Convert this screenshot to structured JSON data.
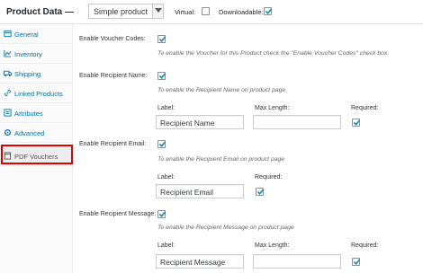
{
  "header": {
    "title": "Product Data —",
    "product_type": "Simple product",
    "virtual_label": "Virtual:",
    "downloadable_label": "Downloadable:"
  },
  "sidebar": {
    "items": [
      {
        "label": "General",
        "icon": "wrench-icon"
      },
      {
        "label": "Inventory",
        "icon": "chart-icon"
      },
      {
        "label": "Shipping",
        "icon": "truck-icon"
      },
      {
        "label": "Linked Products",
        "icon": "link-icon"
      },
      {
        "label": "Attributes",
        "icon": "list-icon"
      },
      {
        "label": "Advanced",
        "icon": "gear-icon"
      },
      {
        "label": "PDF Vouchers",
        "icon": "document-icon"
      }
    ]
  },
  "fields": {
    "voucher_codes": {
      "label": "Enable Voucher Codes:",
      "desc": "To enable the Voucher for this Product check the \"Enable Voucher Codes\" check box."
    },
    "recipient_name": {
      "label": "Enable Recipient Name:",
      "desc": "To enable the Recipient Name on product page",
      "label_caption": "Label:",
      "label_value": "Recipient Name",
      "maxlength_caption": "Max Length:",
      "maxlength_value": "",
      "required_caption": "Required:"
    },
    "recipient_email": {
      "label": "Enable Recipient Email:",
      "desc": "To enable the Recipient Email on product page",
      "label_caption": "Label:",
      "label_value": "Recipient Email",
      "required_caption": "Required:"
    },
    "recipient_message": {
      "label": "Enable Recipient Message:",
      "desc": "To enable the Recipient Message on product page",
      "label_caption": "Label:",
      "label_value": "Recipient Message",
      "maxlength_caption": "Max Length:",
      "maxlength_value": "",
      "required_caption": "Required:"
    }
  },
  "colors": {
    "link": "#0073aa",
    "highlight": "#e00000",
    "checkmark": "#1e8cbe"
  }
}
